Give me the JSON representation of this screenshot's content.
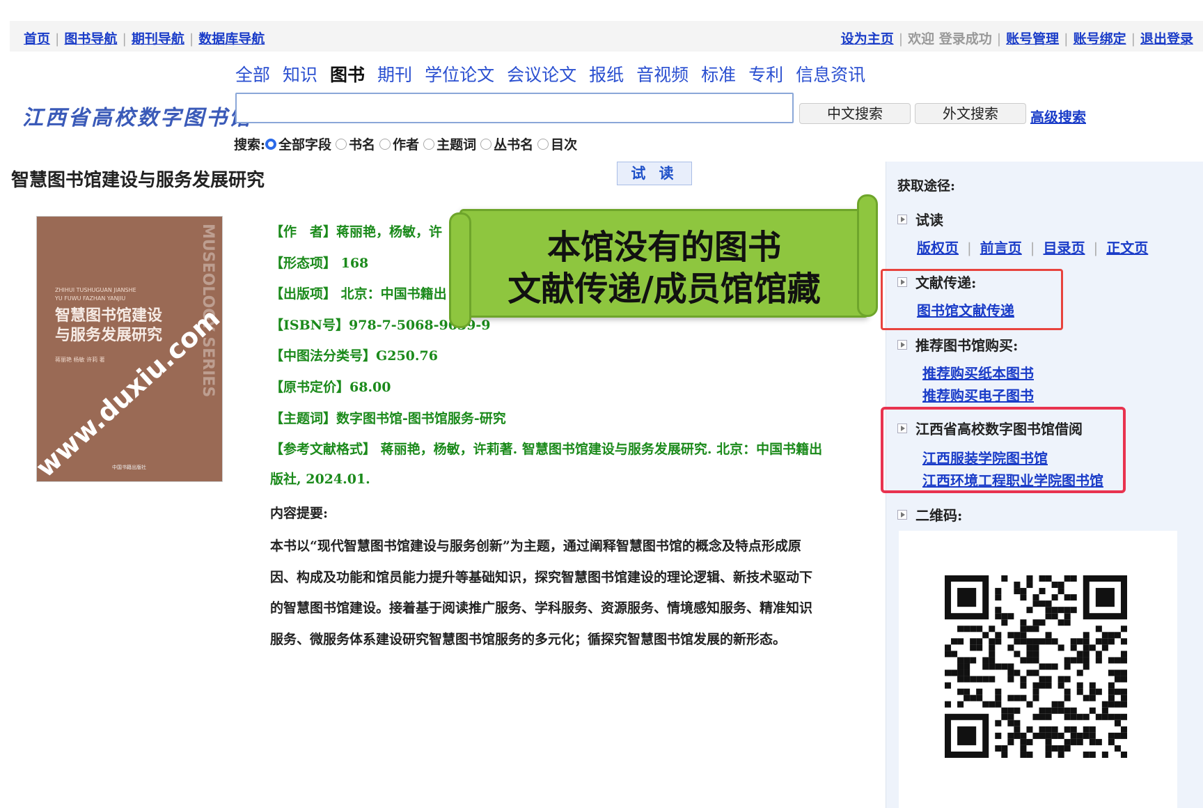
{
  "top_nav": {
    "left": [
      "首页",
      "图书导航",
      "期刊导航",
      "数据库导航"
    ],
    "set_home": "设为主页",
    "welcome": "欢迎 登录成功",
    "account_manage": "账号管理",
    "account_bind": "账号绑定",
    "logout": "退出登录"
  },
  "categories": [
    "全部",
    "知识",
    "图书",
    "期刊",
    "学位论文",
    "会议论文",
    "报纸",
    "音视频",
    "标准",
    "专利",
    "信息资讯"
  ],
  "active_category": "图书",
  "logo_text": "江西省高校数字图书馆",
  "search": {
    "value": "",
    "cn_button": "中文搜索",
    "foreign_button": "外文搜索",
    "advanced": "高级搜索",
    "label": "搜索:",
    "options": [
      "全部字段",
      "书名",
      "作者",
      "主题词",
      "丛书名",
      "目次"
    ],
    "selected": "全部字段"
  },
  "book": {
    "title": "智慧图书馆建设与服务发展研究",
    "try_read_button": "试 读",
    "cover": {
      "pinyin": "ZHIHUI TUSHUGUAN JIANSHE\nYU FUWU FAZHAN YANJIU",
      "title_line1": "智慧图书馆建设",
      "title_line2": "与服务发展研究",
      "authors": "蒋丽艳  杨敏  许莉  著",
      "side_text": "MUSEOLOGY SERIES",
      "watermark": "www.duxiu.com",
      "publisher": "中国书籍出版社"
    },
    "meta": {
      "author": "【作　者】蒋丽艳，杨敏，许",
      "pages": "【形态项】 168",
      "publish": "【出版项】 北京：中国书籍出",
      "isbn": "【ISBN号】978-7-5068-9639-9",
      "clc": "【中图法分类号】G250.76",
      "price": "【原书定价】68.00",
      "subject": "【主题词】数字图书馆-图书馆服务-研究",
      "citation_line1": "【参考文献格式】 蒋丽艳，杨敏，许莉著. 智慧图书馆建设与服务发展研究. 北京：中国书籍出",
      "citation_line2": "版社, 2024.01."
    },
    "summary_label": "内容提要:",
    "summary_lines": [
      "本书以“现代智慧图书馆建设与服务创新”为主题，通过阐释智慧图书馆的概念及特点形成原",
      "因、构成及功能和馆员能力提升等基础知识，探究智慧图书馆建设的理论逻辑、新技术驱动下",
      "的智慧图书馆建设。接着基于阅读推广服务、学科服务、资源服务、情境感知服务、精准知识",
      "服务、微服务体系建设研究智慧图书馆服务的多元化；循探究智慧图书馆发展的新形态。"
    ]
  },
  "callout": {
    "line1": "本馆没有的图书",
    "line2": "文献传递/成员馆馆藏"
  },
  "panel": {
    "title": "获取途径:",
    "try_read": "试读",
    "try_links": [
      "版权页",
      "前言页",
      "目录页",
      "正文页"
    ],
    "delivery_label": "文献传递:",
    "delivery_link": "图书馆文献传递",
    "recommend_label": "推荐图书馆购买:",
    "recommend_links": [
      "推荐购买纸本图书",
      "推荐购买电子图书"
    ],
    "borrow_label": "江西省高校数字图书馆借阅",
    "borrow_links": [
      "江西服装学院图书馆",
      "江西环境工程职业学院图书馆"
    ],
    "qr_label": "二维码:"
  },
  "colors": {
    "link": "#1a3cc8",
    "meta_green": "#1b8a1b",
    "callout_green": "#8ec63f",
    "highlight_red": "#e8433d",
    "panel_bg": "#eef3fb"
  }
}
